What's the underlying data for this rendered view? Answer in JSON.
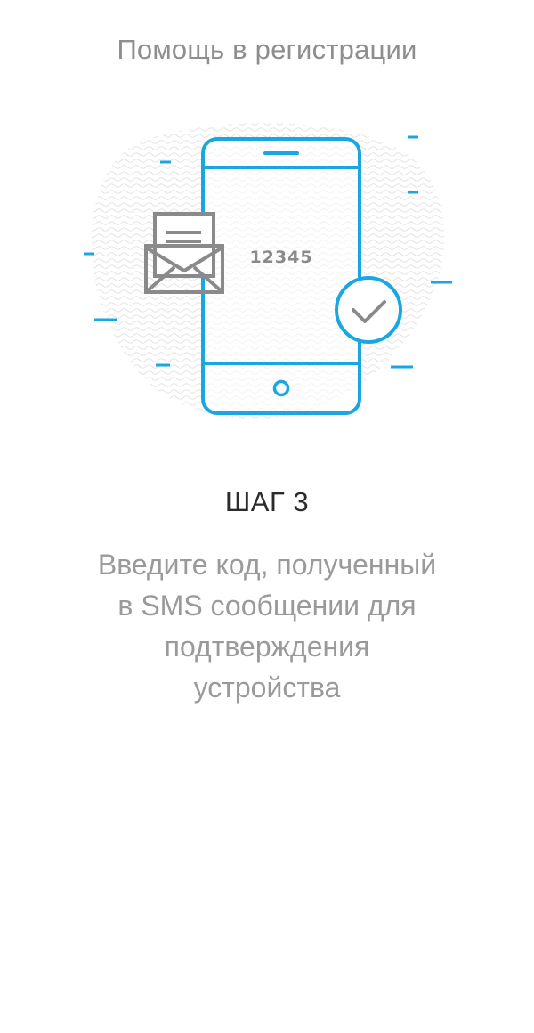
{
  "header": {
    "title": "Помощь в регистрации"
  },
  "illustration": {
    "code": "12345",
    "accent_color": "#1aa7e0",
    "icon_color": "#8a8a8a",
    "icons": [
      "smartphone-icon",
      "envelope-icon",
      "checkmark-circle-icon"
    ]
  },
  "step": {
    "title": "ШАГ 3",
    "description_lines": [
      "Введите код, полученный",
      "в SMS сообщении для",
      "подтверждения",
      "устройства"
    ]
  }
}
